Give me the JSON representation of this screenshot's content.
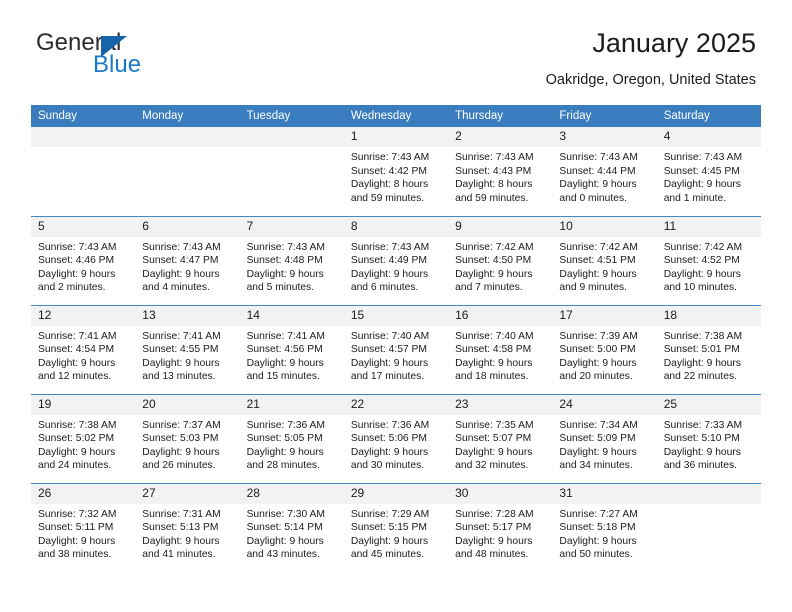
{
  "brand": {
    "name_top": "General",
    "name_bottom": "Blue",
    "color_dark": "#2d2d2d",
    "color_blue": "#1b7ac7",
    "triangle_color": "#1565a8"
  },
  "header": {
    "title": "January 2025",
    "subtitle": "Oakridge, Oregon, United States",
    "accent_color": "#3a7dbe",
    "daynum_band_color": "#f2f2f2"
  },
  "weekday_headers": [
    "Sunday",
    "Monday",
    "Tuesday",
    "Wednesday",
    "Thursday",
    "Friday",
    "Saturday"
  ],
  "labels": {
    "sunrise": "Sunrise:",
    "sunset": "Sunset:",
    "daylight": "Daylight:"
  },
  "weeks": [
    [
      {
        "day": "",
        "empty": true,
        "sunrise": "",
        "sunset": "",
        "daylight_1": "",
        "daylight_2": ""
      },
      {
        "day": "",
        "empty": true,
        "sunrise": "",
        "sunset": "",
        "daylight_1": "",
        "daylight_2": ""
      },
      {
        "day": "",
        "empty": true,
        "sunrise": "",
        "sunset": "",
        "daylight_1": "",
        "daylight_2": ""
      },
      {
        "day": "1",
        "empty": false,
        "sunrise": "Sunrise: 7:43 AM",
        "sunset": "Sunset: 4:42 PM",
        "daylight_1": "Daylight: 8 hours",
        "daylight_2": "and 59 minutes."
      },
      {
        "day": "2",
        "empty": false,
        "sunrise": "Sunrise: 7:43 AM",
        "sunset": "Sunset: 4:43 PM",
        "daylight_1": "Daylight: 8 hours",
        "daylight_2": "and 59 minutes."
      },
      {
        "day": "3",
        "empty": false,
        "sunrise": "Sunrise: 7:43 AM",
        "sunset": "Sunset: 4:44 PM",
        "daylight_1": "Daylight: 9 hours",
        "daylight_2": "and 0 minutes."
      },
      {
        "day": "4",
        "empty": false,
        "sunrise": "Sunrise: 7:43 AM",
        "sunset": "Sunset: 4:45 PM",
        "daylight_1": "Daylight: 9 hours",
        "daylight_2": "and 1 minute."
      }
    ],
    [
      {
        "day": "5",
        "empty": false,
        "sunrise": "Sunrise: 7:43 AM",
        "sunset": "Sunset: 4:46 PM",
        "daylight_1": "Daylight: 9 hours",
        "daylight_2": "and 2 minutes."
      },
      {
        "day": "6",
        "empty": false,
        "sunrise": "Sunrise: 7:43 AM",
        "sunset": "Sunset: 4:47 PM",
        "daylight_1": "Daylight: 9 hours",
        "daylight_2": "and 4 minutes."
      },
      {
        "day": "7",
        "empty": false,
        "sunrise": "Sunrise: 7:43 AM",
        "sunset": "Sunset: 4:48 PM",
        "daylight_1": "Daylight: 9 hours",
        "daylight_2": "and 5 minutes."
      },
      {
        "day": "8",
        "empty": false,
        "sunrise": "Sunrise: 7:43 AM",
        "sunset": "Sunset: 4:49 PM",
        "daylight_1": "Daylight: 9 hours",
        "daylight_2": "and 6 minutes."
      },
      {
        "day": "9",
        "empty": false,
        "sunrise": "Sunrise: 7:42 AM",
        "sunset": "Sunset: 4:50 PM",
        "daylight_1": "Daylight: 9 hours",
        "daylight_2": "and 7 minutes."
      },
      {
        "day": "10",
        "empty": false,
        "sunrise": "Sunrise: 7:42 AM",
        "sunset": "Sunset: 4:51 PM",
        "daylight_1": "Daylight: 9 hours",
        "daylight_2": "and 9 minutes."
      },
      {
        "day": "11",
        "empty": false,
        "sunrise": "Sunrise: 7:42 AM",
        "sunset": "Sunset: 4:52 PM",
        "daylight_1": "Daylight: 9 hours",
        "daylight_2": "and 10 minutes."
      }
    ],
    [
      {
        "day": "12",
        "empty": false,
        "sunrise": "Sunrise: 7:41 AM",
        "sunset": "Sunset: 4:54 PM",
        "daylight_1": "Daylight: 9 hours",
        "daylight_2": "and 12 minutes."
      },
      {
        "day": "13",
        "empty": false,
        "sunrise": "Sunrise: 7:41 AM",
        "sunset": "Sunset: 4:55 PM",
        "daylight_1": "Daylight: 9 hours",
        "daylight_2": "and 13 minutes."
      },
      {
        "day": "14",
        "empty": false,
        "sunrise": "Sunrise: 7:41 AM",
        "sunset": "Sunset: 4:56 PM",
        "daylight_1": "Daylight: 9 hours",
        "daylight_2": "and 15 minutes."
      },
      {
        "day": "15",
        "empty": false,
        "sunrise": "Sunrise: 7:40 AM",
        "sunset": "Sunset: 4:57 PM",
        "daylight_1": "Daylight: 9 hours",
        "daylight_2": "and 17 minutes."
      },
      {
        "day": "16",
        "empty": false,
        "sunrise": "Sunrise: 7:40 AM",
        "sunset": "Sunset: 4:58 PM",
        "daylight_1": "Daylight: 9 hours",
        "daylight_2": "and 18 minutes."
      },
      {
        "day": "17",
        "empty": false,
        "sunrise": "Sunrise: 7:39 AM",
        "sunset": "Sunset: 5:00 PM",
        "daylight_1": "Daylight: 9 hours",
        "daylight_2": "and 20 minutes."
      },
      {
        "day": "18",
        "empty": false,
        "sunrise": "Sunrise: 7:38 AM",
        "sunset": "Sunset: 5:01 PM",
        "daylight_1": "Daylight: 9 hours",
        "daylight_2": "and 22 minutes."
      }
    ],
    [
      {
        "day": "19",
        "empty": false,
        "sunrise": "Sunrise: 7:38 AM",
        "sunset": "Sunset: 5:02 PM",
        "daylight_1": "Daylight: 9 hours",
        "daylight_2": "and 24 minutes."
      },
      {
        "day": "20",
        "empty": false,
        "sunrise": "Sunrise: 7:37 AM",
        "sunset": "Sunset: 5:03 PM",
        "daylight_1": "Daylight: 9 hours",
        "daylight_2": "and 26 minutes."
      },
      {
        "day": "21",
        "empty": false,
        "sunrise": "Sunrise: 7:36 AM",
        "sunset": "Sunset: 5:05 PM",
        "daylight_1": "Daylight: 9 hours",
        "daylight_2": "and 28 minutes."
      },
      {
        "day": "22",
        "empty": false,
        "sunrise": "Sunrise: 7:36 AM",
        "sunset": "Sunset: 5:06 PM",
        "daylight_1": "Daylight: 9 hours",
        "daylight_2": "and 30 minutes."
      },
      {
        "day": "23",
        "empty": false,
        "sunrise": "Sunrise: 7:35 AM",
        "sunset": "Sunset: 5:07 PM",
        "daylight_1": "Daylight: 9 hours",
        "daylight_2": "and 32 minutes."
      },
      {
        "day": "24",
        "empty": false,
        "sunrise": "Sunrise: 7:34 AM",
        "sunset": "Sunset: 5:09 PM",
        "daylight_1": "Daylight: 9 hours",
        "daylight_2": "and 34 minutes."
      },
      {
        "day": "25",
        "empty": false,
        "sunrise": "Sunrise: 7:33 AM",
        "sunset": "Sunset: 5:10 PM",
        "daylight_1": "Daylight: 9 hours",
        "daylight_2": "and 36 minutes."
      }
    ],
    [
      {
        "day": "26",
        "empty": false,
        "sunrise": "Sunrise: 7:32 AM",
        "sunset": "Sunset: 5:11 PM",
        "daylight_1": "Daylight: 9 hours",
        "daylight_2": "and 38 minutes."
      },
      {
        "day": "27",
        "empty": false,
        "sunrise": "Sunrise: 7:31 AM",
        "sunset": "Sunset: 5:13 PM",
        "daylight_1": "Daylight: 9 hours",
        "daylight_2": "and 41 minutes."
      },
      {
        "day": "28",
        "empty": false,
        "sunrise": "Sunrise: 7:30 AM",
        "sunset": "Sunset: 5:14 PM",
        "daylight_1": "Daylight: 9 hours",
        "daylight_2": "and 43 minutes."
      },
      {
        "day": "29",
        "empty": false,
        "sunrise": "Sunrise: 7:29 AM",
        "sunset": "Sunset: 5:15 PM",
        "daylight_1": "Daylight: 9 hours",
        "daylight_2": "and 45 minutes."
      },
      {
        "day": "30",
        "empty": false,
        "sunrise": "Sunrise: 7:28 AM",
        "sunset": "Sunset: 5:17 PM",
        "daylight_1": "Daylight: 9 hours",
        "daylight_2": "and 48 minutes."
      },
      {
        "day": "31",
        "empty": false,
        "sunrise": "Sunrise: 7:27 AM",
        "sunset": "Sunset: 5:18 PM",
        "daylight_1": "Daylight: 9 hours",
        "daylight_2": "and 50 minutes."
      },
      {
        "day": "",
        "empty": true,
        "sunrise": "",
        "sunset": "",
        "daylight_1": "",
        "daylight_2": ""
      }
    ]
  ]
}
